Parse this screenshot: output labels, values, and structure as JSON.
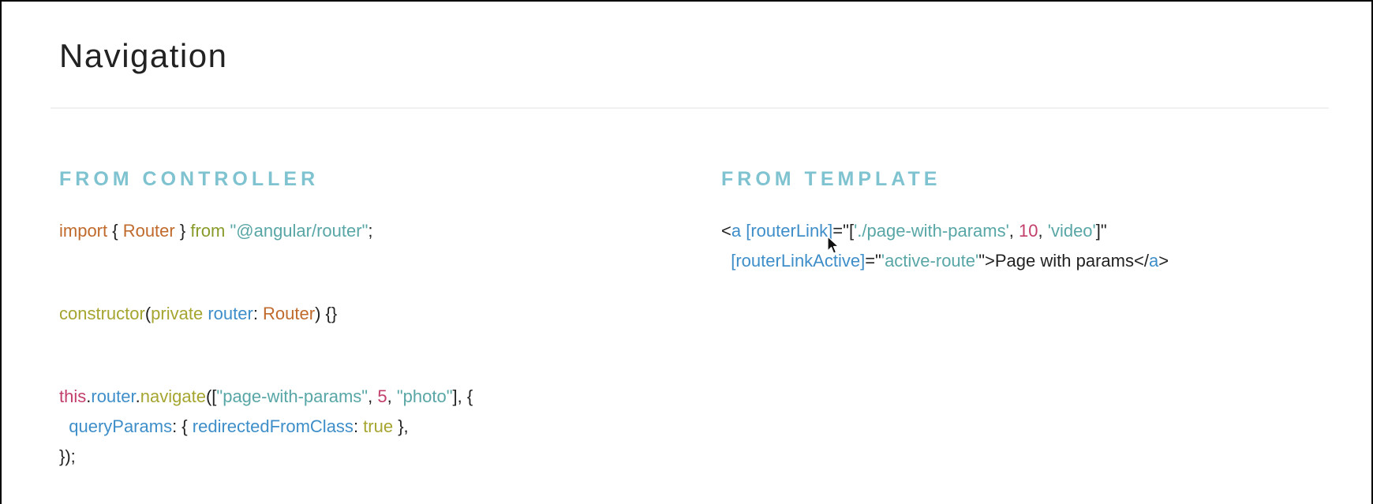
{
  "slide": {
    "title": "Navigation",
    "controller_heading": "FROM CONTROLLER",
    "template_heading": "FROM TEMPLATE"
  },
  "controller_code": {
    "import": {
      "kw_import": "import",
      "open": " { ",
      "router": "Router",
      "close": " } ",
      "kw_from": "from",
      "space": " ",
      "module": "\"@angular/router\"",
      "end": ";"
    },
    "ctor": {
      "fn": "constructor",
      "open": "(",
      "kw_private": "private",
      "space": " ",
      "prop": "router",
      "colon": ": ",
      "type": "Router",
      "end": ") {}"
    },
    "navigate": {
      "this": "this",
      "dot1": ".",
      "router": "router",
      "dot2": ".",
      "fn": "navigate",
      "open": "([",
      "str1": "\"page-with-params\"",
      "comma1": ", ",
      "num": "5",
      "comma2": ", ",
      "str2": "\"photo\"",
      "close": "], {",
      "indent": "  ",
      "query_params": "queryParams",
      "qp_open": ": { ",
      "redirected": "redirectedFromClass",
      "colon": ": ",
      "bool": "true",
      "qp_close": " },",
      "end": "});"
    }
  },
  "template_code": {
    "lt": "<",
    "tag_a": "a",
    "space": " ",
    "router_link": "[routerLink]",
    "eq1": "=\"",
    "arr_open": "[",
    "s1": "'./page-with-params'",
    "comma1": ", ",
    "num": "10",
    "comma2": ", ",
    "s2": "'video'",
    "arr_close": "]\"",
    "indent": "  ",
    "router_link_active": "[routerLinkActive]",
    "eq2": "=\"",
    "s3": "'active-route'",
    "q_close": "\"",
    "gt_text": ">Page with params</",
    "tag_a_close": "a",
    "gt": ">"
  },
  "icons": {
    "cursor": "mouse-pointer-icon"
  }
}
